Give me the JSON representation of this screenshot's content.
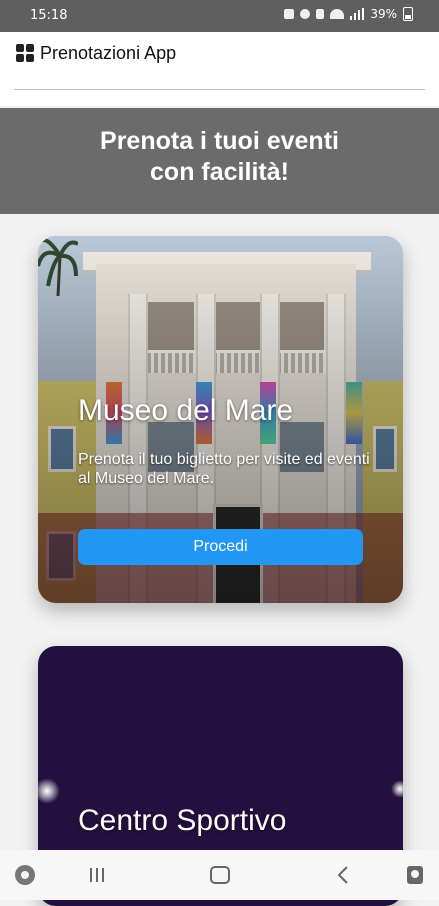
{
  "status_bar": {
    "time": "15:18",
    "battery": "39%",
    "icons": [
      "lock-icon",
      "alarm-icon",
      "mute-icon",
      "wifi-icon",
      "signal-icon",
      "battery-icon"
    ]
  },
  "app_bar": {
    "title": "Prenotazioni App",
    "icon": "grid-apps-icon"
  },
  "hero": {
    "title_line1": "Prenota i tuoi eventi",
    "title_line2": "con facilità!",
    "background": "#6b6b6b"
  },
  "cards": [
    {
      "title": "Museo del Mare",
      "description": "Prenota il tuo biglietto per visite ed eventi al Museo del Mare.",
      "button_label": "Procedi",
      "button_color": "#2196f3"
    },
    {
      "title": "Centro Sportivo"
    }
  ],
  "nav_bar": {
    "buttons": [
      "assistant-icon",
      "recents-icon",
      "home-icon",
      "back-icon",
      "accessibility-icon"
    ]
  }
}
